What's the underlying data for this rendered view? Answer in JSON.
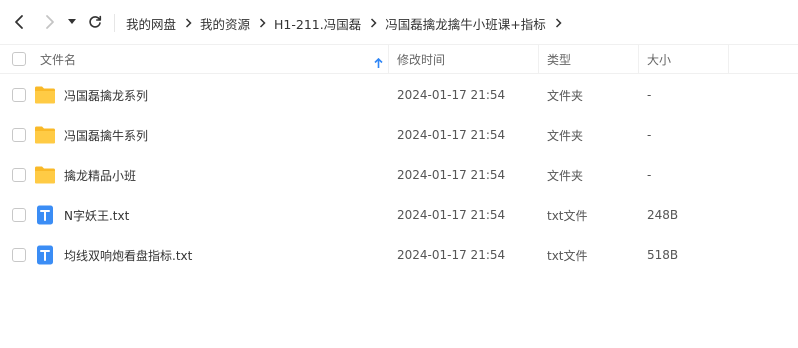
{
  "toolbar": {
    "back_icon": "chevron-left-icon",
    "forward_icon": "chevron-right-icon",
    "history_icon": "caret-down-icon",
    "refresh_icon": "refresh-icon"
  },
  "breadcrumb": [
    "我的网盘",
    "我的资源",
    "H1-211.冯国磊",
    "冯国磊擒龙擒牛小班课+指标"
  ],
  "table": {
    "columns": {
      "name": "文件名",
      "modified": "修改时间",
      "type": "类型",
      "size": "大小"
    },
    "sort_icon": "sort-arrow-up-icon",
    "rows": [
      {
        "name": "冯国磊擒龙系列",
        "modified": "2024-01-17 21:54",
        "type": "文件夹",
        "size": "-",
        "icon": "folder-icon"
      },
      {
        "name": "冯国磊擒牛系列",
        "modified": "2024-01-17 21:54",
        "type": "文件夹",
        "size": "-",
        "icon": "folder-icon"
      },
      {
        "name": "擒龙精品小班",
        "modified": "2024-01-17 21:54",
        "type": "文件夹",
        "size": "-",
        "icon": "folder-icon"
      },
      {
        "name": "N字妖王.txt",
        "modified": "2024-01-17 21:54",
        "type": "txt文件",
        "size": "248B",
        "icon": "txt-file-icon"
      },
      {
        "name": "均线双响炮看盘指标.txt",
        "modified": "2024-01-17 21:54",
        "type": "txt文件",
        "size": "518B",
        "icon": "txt-file-icon"
      }
    ]
  },
  "colors": {
    "folder": "#ffc93c",
    "txt": "#3b8df5",
    "sort_arrow": "#2f86f6"
  }
}
